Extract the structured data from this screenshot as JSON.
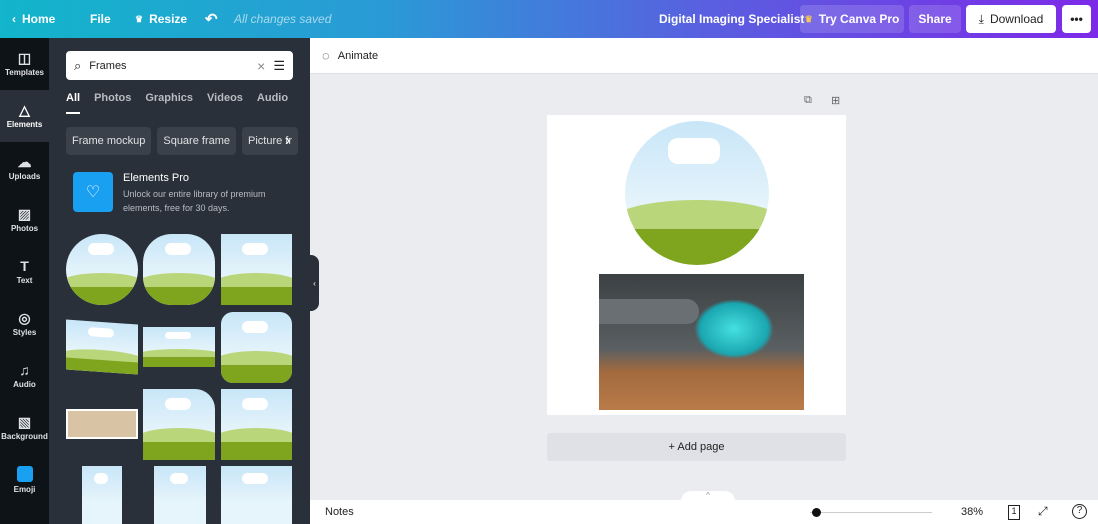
{
  "topbar": {
    "home": "Home",
    "file": "File",
    "resize": "Resize",
    "status": "All changes saved",
    "title": "Digital Imaging Specialist",
    "try_pro": "Try Canva Pro",
    "share": "Share",
    "download": "Download",
    "more": "•••"
  },
  "rail": [
    {
      "label": "Templates",
      "icon": "templates-icon"
    },
    {
      "label": "Elements",
      "icon": "elements-icon"
    },
    {
      "label": "Uploads",
      "icon": "upload-cloud-icon"
    },
    {
      "label": "Photos",
      "icon": "photo-icon"
    },
    {
      "label": "Text",
      "icon": "text-icon"
    },
    {
      "label": "Styles",
      "icon": "palette-icon"
    },
    {
      "label": "Audio",
      "icon": "music-icon"
    },
    {
      "label": "Background",
      "icon": "background-icon"
    },
    {
      "label": "Emoji",
      "icon": "emoji-icon"
    }
  ],
  "panel": {
    "search_value": "Frames",
    "tabs": [
      "All",
      "Photos",
      "Graphics",
      "Videos",
      "Audio"
    ],
    "chips": [
      "Frame mockup",
      "Square frame",
      "Picture fr"
    ],
    "pro_title": "Elements Pro",
    "pro_desc": "Unlock our entire library of premium elements, free for 30 days."
  },
  "toolbar": {
    "animate": "Animate"
  },
  "canvas": {
    "add_page": "+ Add page"
  },
  "bottom": {
    "notes": "Notes",
    "zoom": "38%",
    "zoom_fraction": 0.05,
    "page_count": "1",
    "help": "?"
  },
  "colors": {
    "accent_start": "#12b5cb",
    "accent_end": "#7d2ae8",
    "panel": "#293039",
    "rail": "#0e1318"
  }
}
